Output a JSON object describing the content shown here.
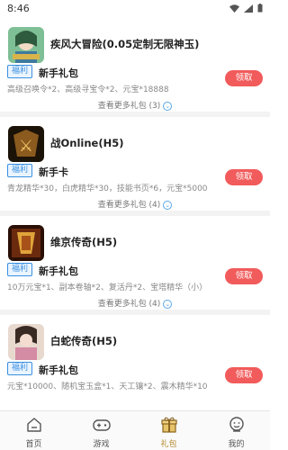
{
  "status": {
    "time": "8:46"
  },
  "games": [
    {
      "title": "疾风大冒险(0.05定制无限神玉)",
      "icon": "game-icon-jifeng",
      "tag": "福利",
      "gift_name": "新手礼包",
      "gift_desc": "高级召唤令*2、高级寻宝令*2、元宝*18888",
      "claim": "领取",
      "more": "查看更多礼包 (3)"
    },
    {
      "title": "战Online(H5)",
      "icon": "game-icon-zhan",
      "tag": "福利",
      "gift_name": "新手卡",
      "gift_desc": "青龙精华*30，白虎精华*30，技能书页*6，元宝*5000",
      "claim": "领取",
      "more": "查看更多礼包 (4)"
    },
    {
      "title": "维京传奇(H5)",
      "icon": "game-icon-weijing",
      "tag": "福利",
      "gift_name": "新手礼包",
      "gift_desc": "10万元宝*1、副本卷轴*2、复活丹*2、宝塔精华（小）",
      "claim": "领取",
      "more": "查看更多礼包 (4)"
    },
    {
      "title": "白蛇传奇(H5)",
      "icon": "game-icon-baishe",
      "tag": "福利",
      "gift_name": "新手礼包",
      "gift_desc": "元宝*10000、随机宝玉盒*1、天工镶*2、震木精华*10",
      "claim": "领取",
      "more": ""
    }
  ],
  "tabs": [
    {
      "label": "首页",
      "icon": "home-icon"
    },
    {
      "label": "游戏",
      "icon": "gamepad-icon"
    },
    {
      "label": "礼包",
      "icon": "gift-icon",
      "active": true
    },
    {
      "label": "我的",
      "icon": "profile-icon"
    }
  ],
  "colors": {
    "claim": "#f15b5b",
    "tag": "#3a8fe0",
    "active_tab": "#b58a2e"
  }
}
